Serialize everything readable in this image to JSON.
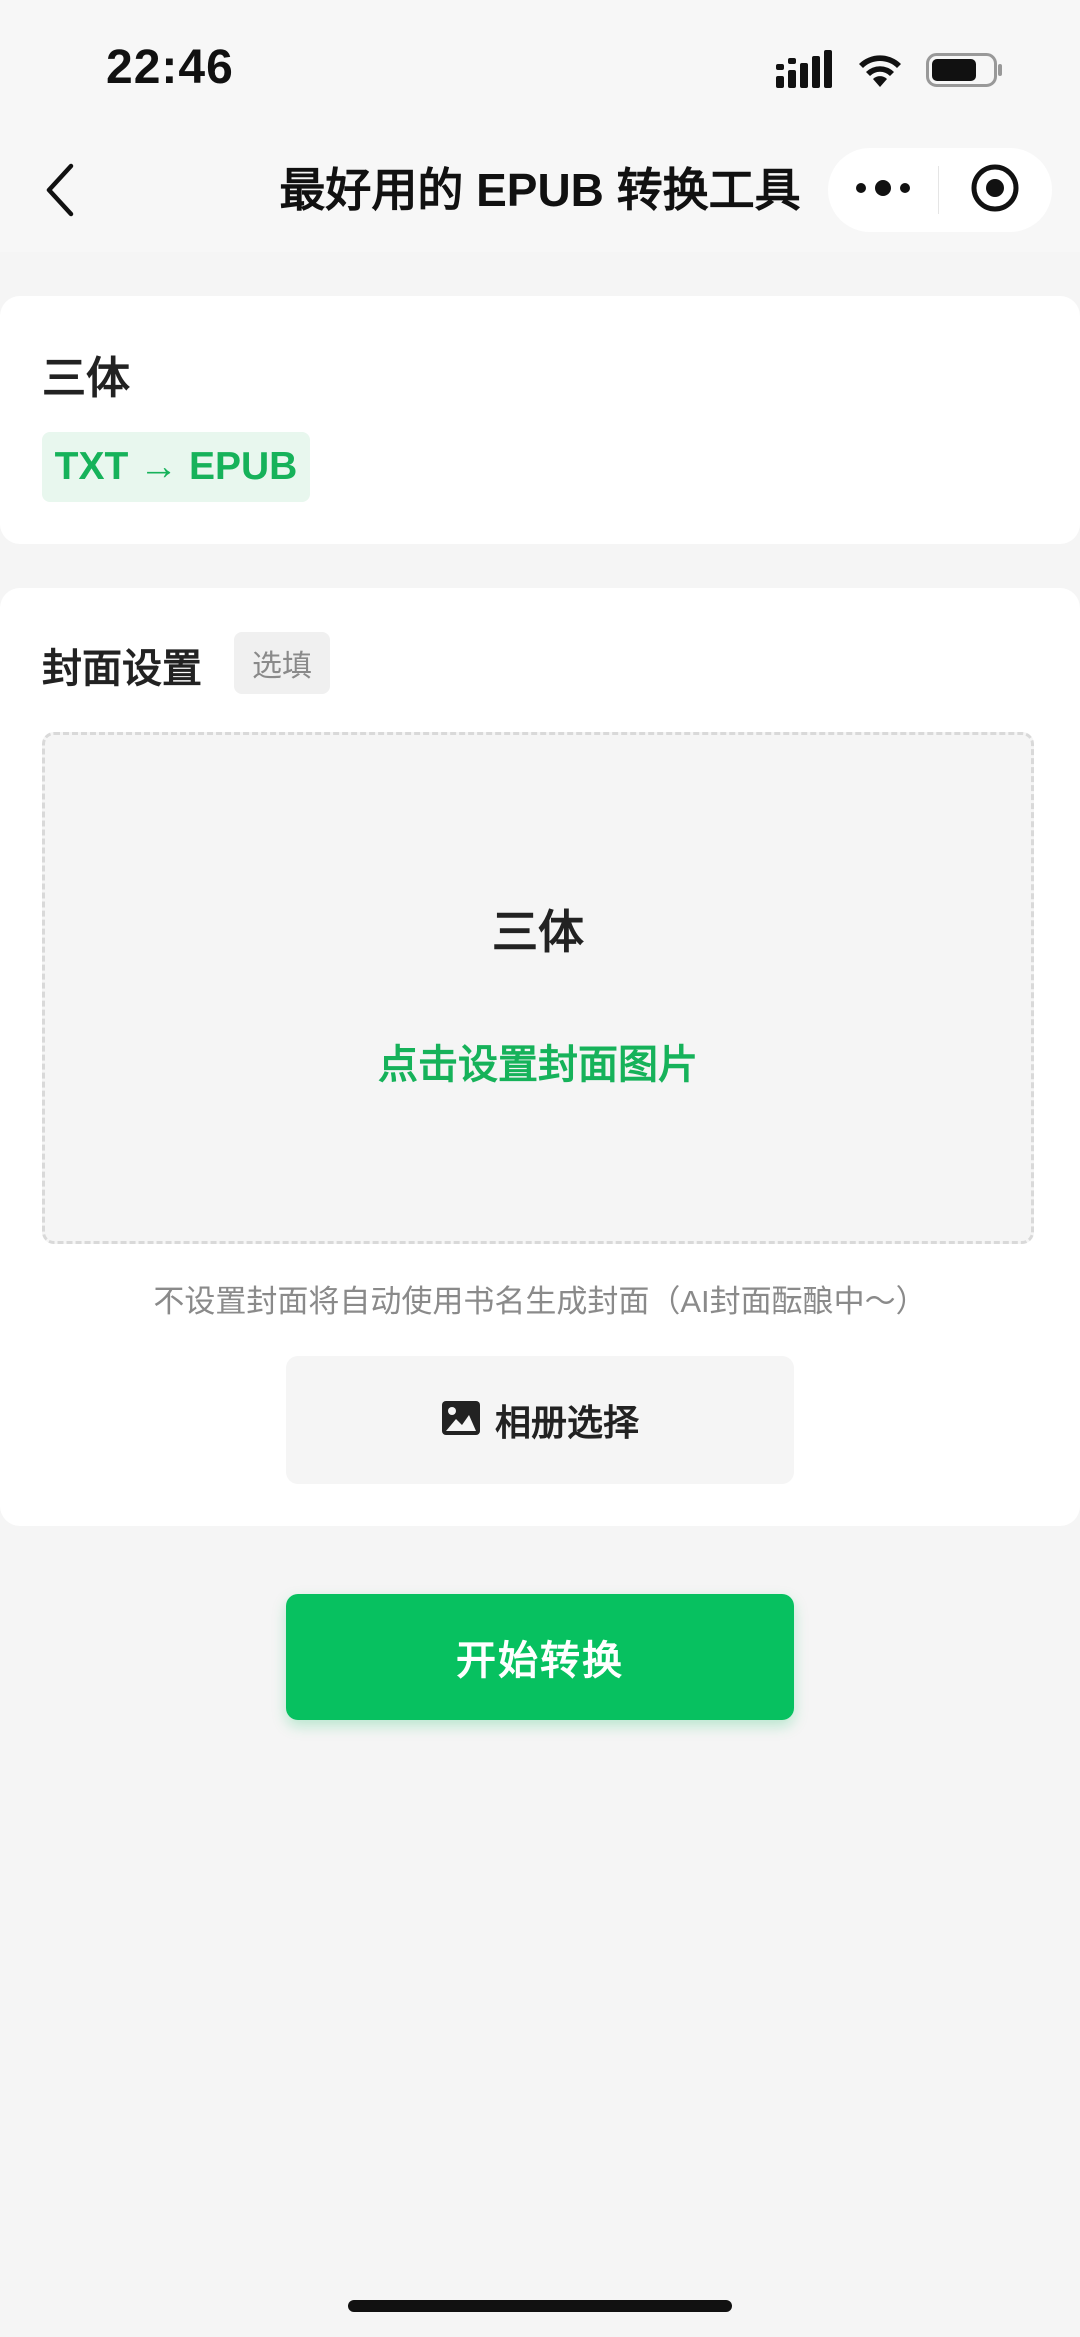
{
  "status_bar": {
    "time": "22:46",
    "icons": [
      "cellular-signal-icon",
      "wifi-icon",
      "battery-icon"
    ]
  },
  "nav": {
    "title": "最好用的 EPUB 转换工具",
    "back_icon": "chevron-left-icon",
    "more_icon": "more-dots-icon",
    "close_icon": "target-circle-icon"
  },
  "book": {
    "title": "三体",
    "format_tag": "TXT → EPUB"
  },
  "cover_settings": {
    "heading": "封面设置",
    "optional_tag": "选填",
    "preview_title": "三体",
    "upload_hint": "点击设置封面图片",
    "note": "不设置封面将自动使用书名生成封面（AI封面酝酿中～）",
    "album_button_label": "相册选择",
    "album_icon": "image-icon"
  },
  "actions": {
    "start_label": "开始转换"
  },
  "colors": {
    "accent_green": "#07c160",
    "hint_green": "#16b25a",
    "tag_bg": "#e8f7ee",
    "page_bg": "#f5f5f5"
  }
}
